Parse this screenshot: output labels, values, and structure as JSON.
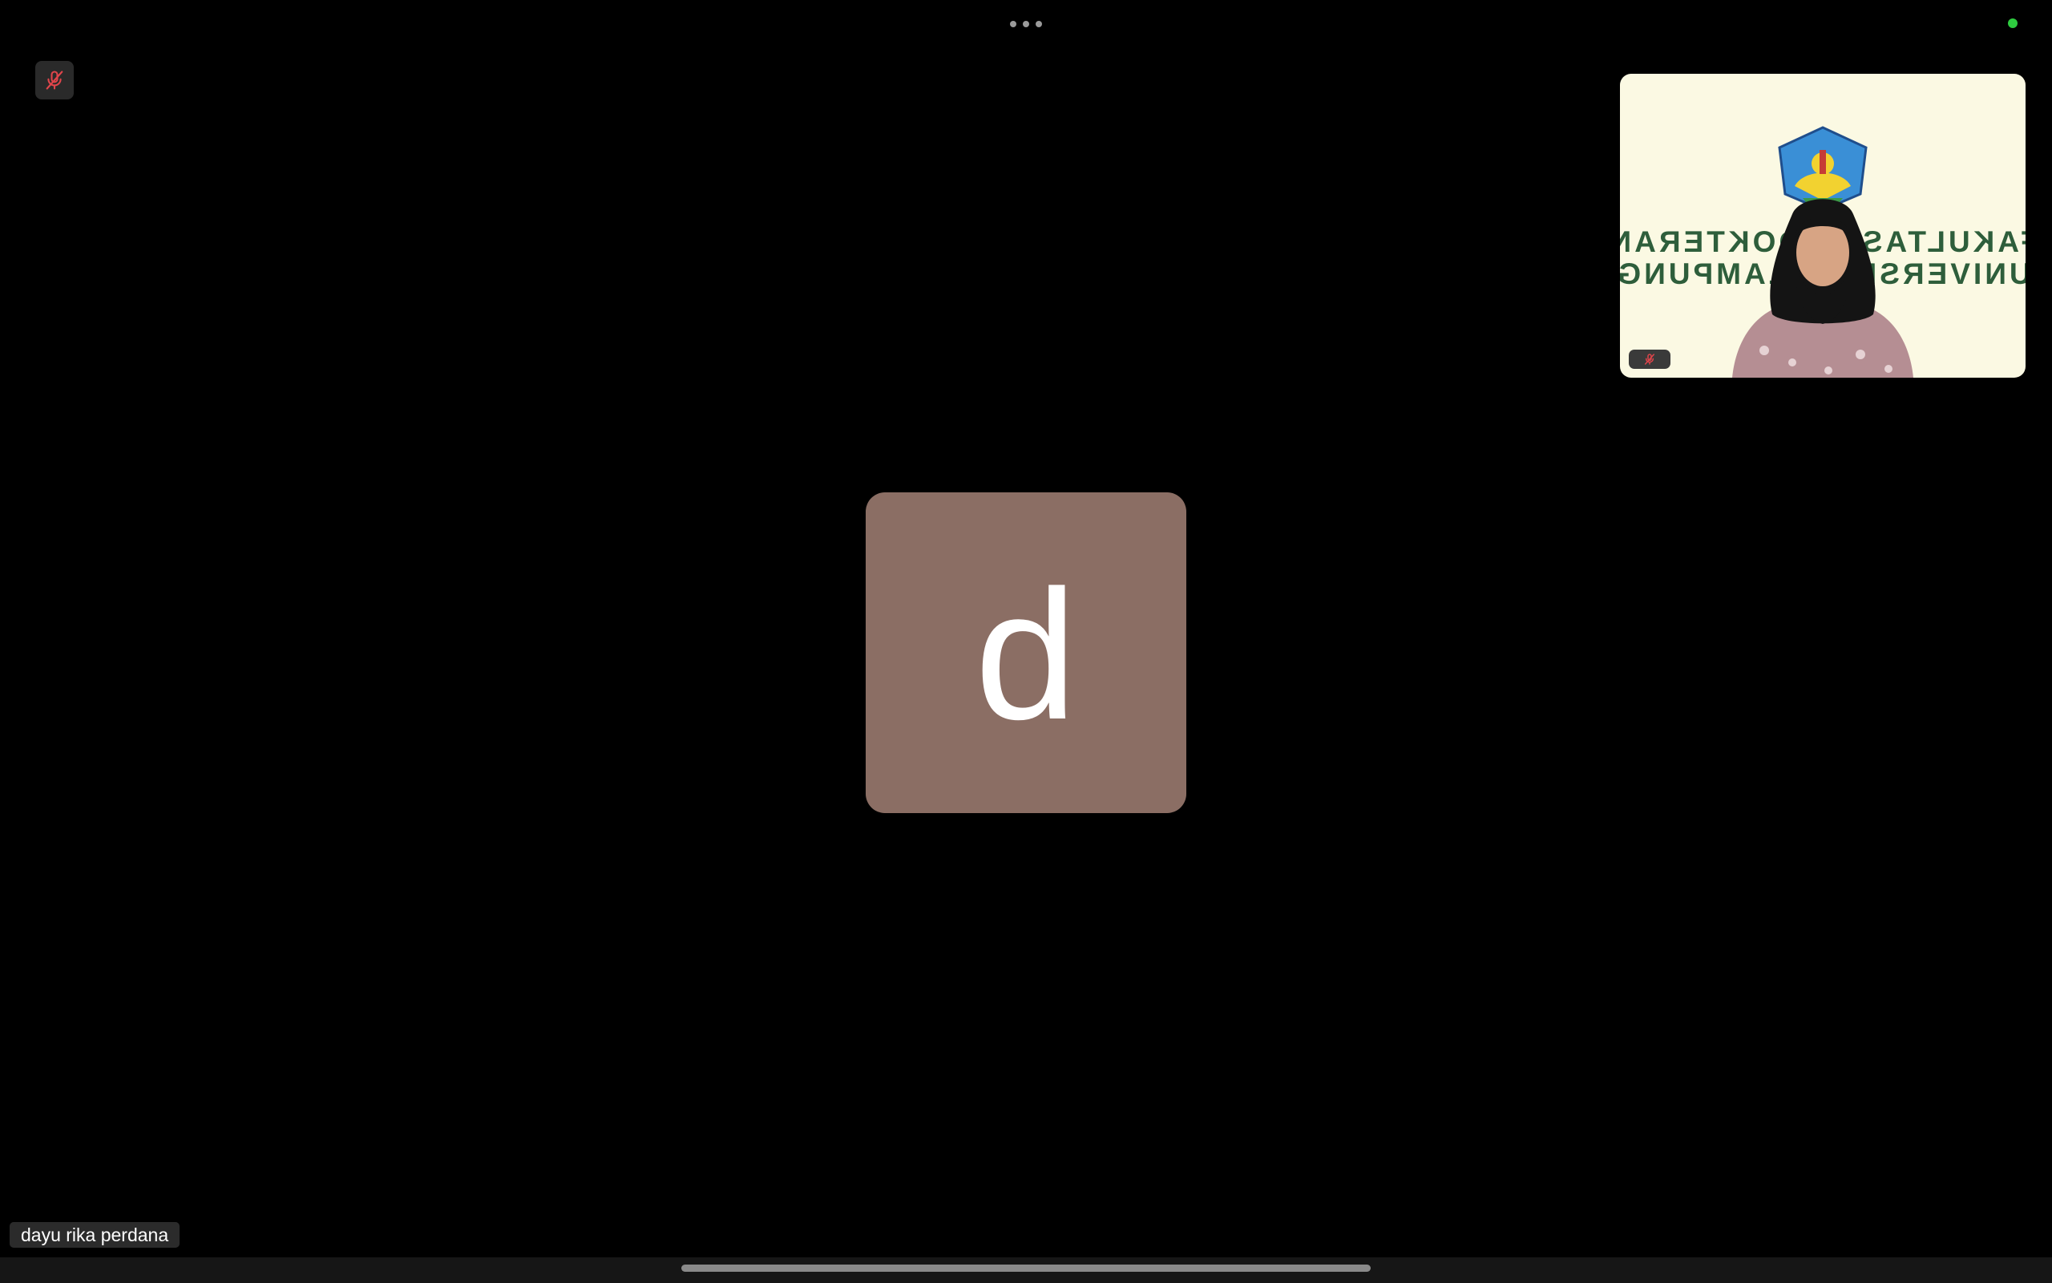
{
  "top": {
    "more_icon": "ellipsis-icon",
    "status_indicator_color": "#2ecc40"
  },
  "self_tile": {
    "muted_icon": "mic-off-icon",
    "muted_icon_color": "#e0454b"
  },
  "active_speaker": {
    "avatar_letter": "d",
    "avatar_color": "#8b6e64",
    "name": "dayu rika perdana"
  },
  "thumbnail": {
    "banner_line_1": "FAKULTAS KEDOKTERAN",
    "banner_line_2": "UNIVERSITAS LAMPUNG",
    "background_color": "#fbf9e3",
    "text_color": "#2e5e3b",
    "muted_icon": "mic-off-icon",
    "muted_icon_color": "#e0454b"
  },
  "colors": {
    "background": "#000000",
    "name_label_bg": "#2b2b2b"
  }
}
